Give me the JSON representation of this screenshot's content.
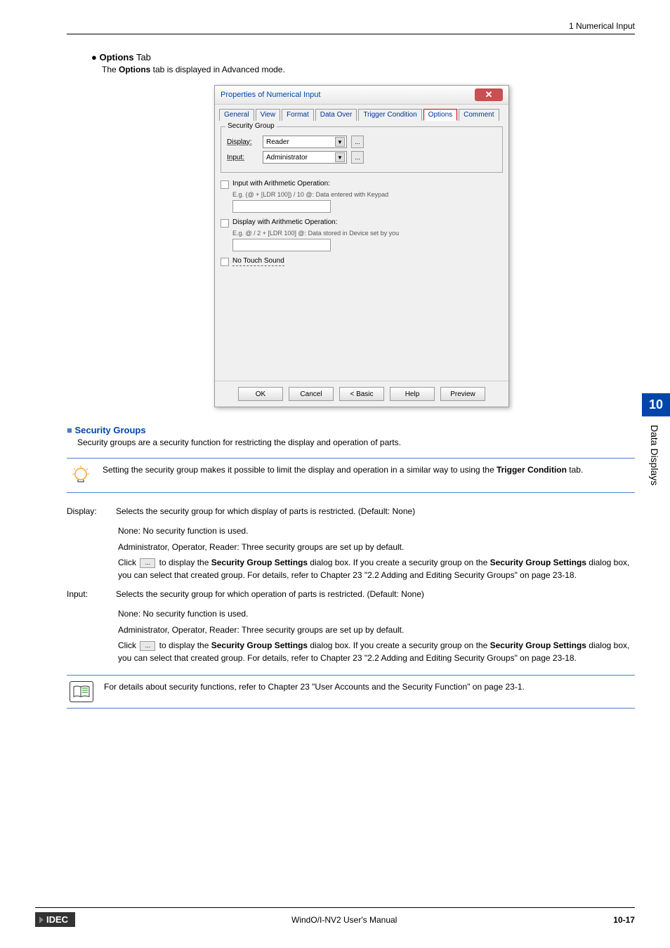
{
  "header": {
    "right": "1 Numerical Input"
  },
  "options_section": {
    "title_prefix": "● ",
    "title_bold": "Options",
    "title_suffix": " Tab",
    "subtitle_pre": "The ",
    "subtitle_bold": "Options",
    "subtitle_post": " tab is displayed in Advanced mode."
  },
  "dialog": {
    "title": "Properties of Numerical Input",
    "tabs": [
      "General",
      "View",
      "Format",
      "Data Over",
      "Trigger Condition",
      "Options",
      "Comment"
    ],
    "active_tab_index": 5,
    "security_group": {
      "legend": "Security Group",
      "display_label": "Display:",
      "display_value": "Reader",
      "input_label": "Input:",
      "input_value": "Administrator"
    },
    "input_arith": {
      "label": "Input with Arithmetic Operation:",
      "eg": "E.g. (@ + [LDR 100]) / 10   @: Data entered with Keypad"
    },
    "display_arith": {
      "label": "Display with Arithmetic Operation:",
      "eg": "E.g. @ / 2 + [LDR 100]   @: Data stored in Device set by you"
    },
    "no_touch_sound": "No Touch Sound",
    "buttons": [
      "OK",
      "Cancel",
      "< Basic",
      "Help",
      "Preview"
    ]
  },
  "security_groups": {
    "title": "Security Groups",
    "intro": "Security groups are a security function for restricting the display and operation of parts.",
    "tip_pre": "Setting the security group makes it possible to limit the display and operation in a similar way to using the ",
    "tip_bold": "Trigger Condition",
    "tip_post": " tab.",
    "display": {
      "term": "Display:",
      "line1": "Selects the security group for which display of parts is restricted. (Default: None)",
      "none": "None: No security function is used.",
      "admin": "Administrator, Operator, Reader: Three security groups are set up by default.",
      "click_pre": "Click ",
      "click_mid1": " to display the ",
      "sgs1": "Security Group Settings",
      "click_mid2": " dialog box. If you create a security group on the ",
      "sgs2": "Security Group Settings",
      "click_post": " dialog box, you can select that created group. For details, refer to Chapter 23 \"2.2 Adding and Editing Security Groups\" on page 23-18."
    },
    "input": {
      "term": "Input:",
      "line1": "Selects the security group for which operation of parts is restricted. (Default: None)",
      "none": "None: No security function is used.",
      "admin": "Administrator, Operator, Reader: Three security groups are set up by default.",
      "click_pre": "Click ",
      "click_mid1": " to display the ",
      "sgs1": "Security Group Settings",
      "click_mid2": " dialog box. If you create a security group on the ",
      "sgs2": "Security Group Settings",
      "click_post": " dialog box, you can select that created group. For details, refer to Chapter 23 \"2.2 Adding and Editing Security Groups\" on page 23-18."
    },
    "ref_note": "For details about security functions, refer to Chapter 23 \"User Accounts and the Security Function\" on page 23-1."
  },
  "side_tab": {
    "number": "10",
    "text": "Data Displays"
  },
  "footer": {
    "logo": "IDEC",
    "center": "WindO/I-NV2 User's Manual",
    "right": "10-17"
  }
}
